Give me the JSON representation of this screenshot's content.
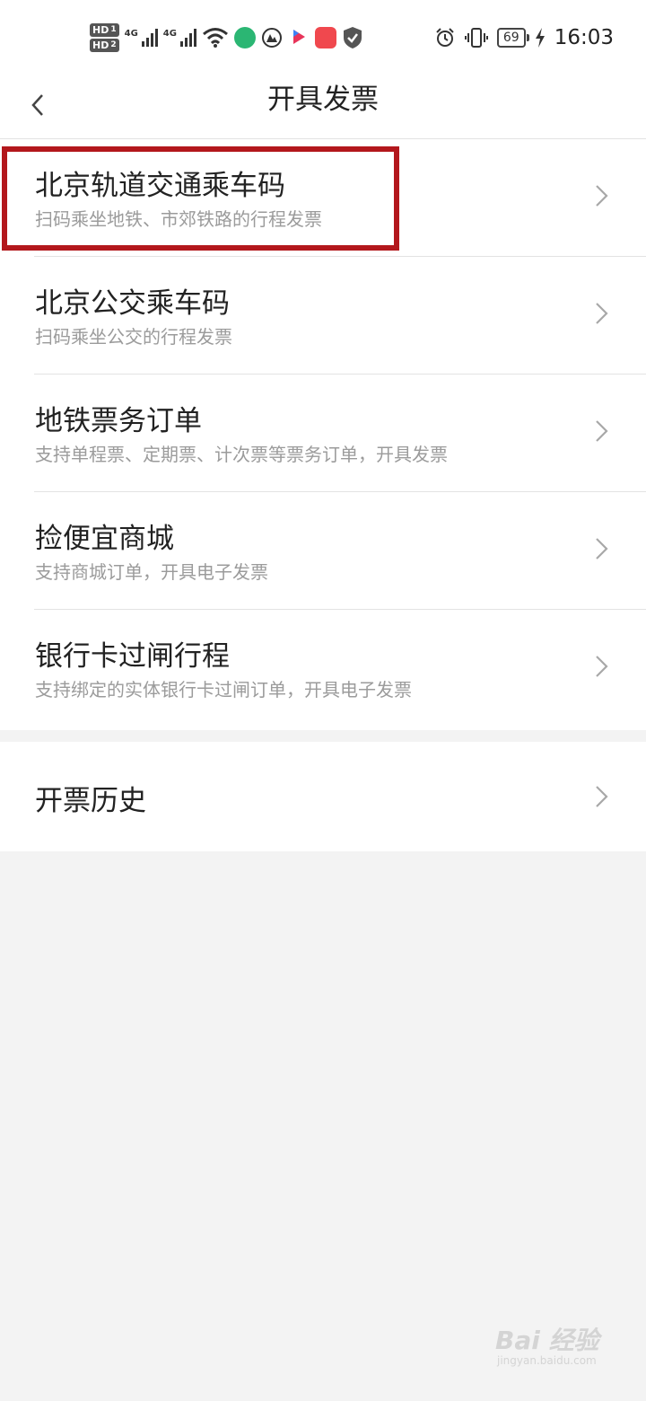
{
  "status_bar": {
    "hd1": "HD",
    "hd1_num": "1",
    "hd2": "HD",
    "hd2_num": "2",
    "net1": "4G",
    "net2": "4G",
    "battery": "69",
    "time": "16:03"
  },
  "header": {
    "title": "开具发票"
  },
  "menu": {
    "items": [
      {
        "title": "北京轨道交通乘车码",
        "subtitle": "扫码乘坐地铁、市郊铁路的行程发票"
      },
      {
        "title": "北京公交乘车码",
        "subtitle": "扫码乘坐公交的行程发票"
      },
      {
        "title": "地铁票务订单",
        "subtitle": "支持单程票、定期票、计次票等票务订单，开具发票"
      },
      {
        "title": "捡便宜商城",
        "subtitle": "支持商城订单，开具电子发票"
      },
      {
        "title": "银行卡过闸行程",
        "subtitle": "支持绑定的实体银行卡过闸订单，开具电子发票"
      }
    ],
    "history": "开票历史"
  },
  "watermark": {
    "main": "Bai 经验",
    "sub": "jingyan.baidu.com"
  },
  "colors": {
    "highlight": "#b3171c",
    "background": "#f3f3f3"
  }
}
